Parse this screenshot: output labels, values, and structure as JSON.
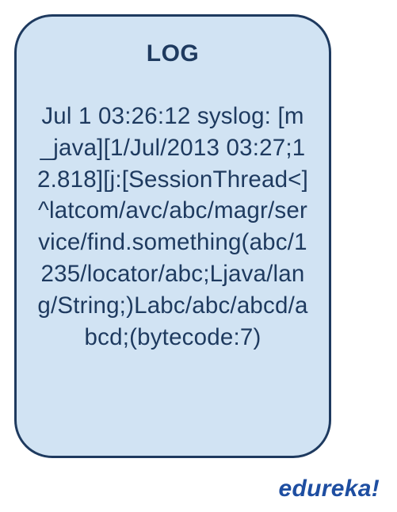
{
  "log": {
    "title": "LOG",
    "body": "Jul 1 03:26:12 syslog: [m_java][1/Jul/2013 03:27;12.818][j:[SessionThread<]^latcom/avc/abc/magr/service/find.something(abc/1235/locator/abc;Ljava/lang/String;)Labc/abc/abcd/abcd;(bytecode:7)"
  },
  "brand": "edureka!"
}
